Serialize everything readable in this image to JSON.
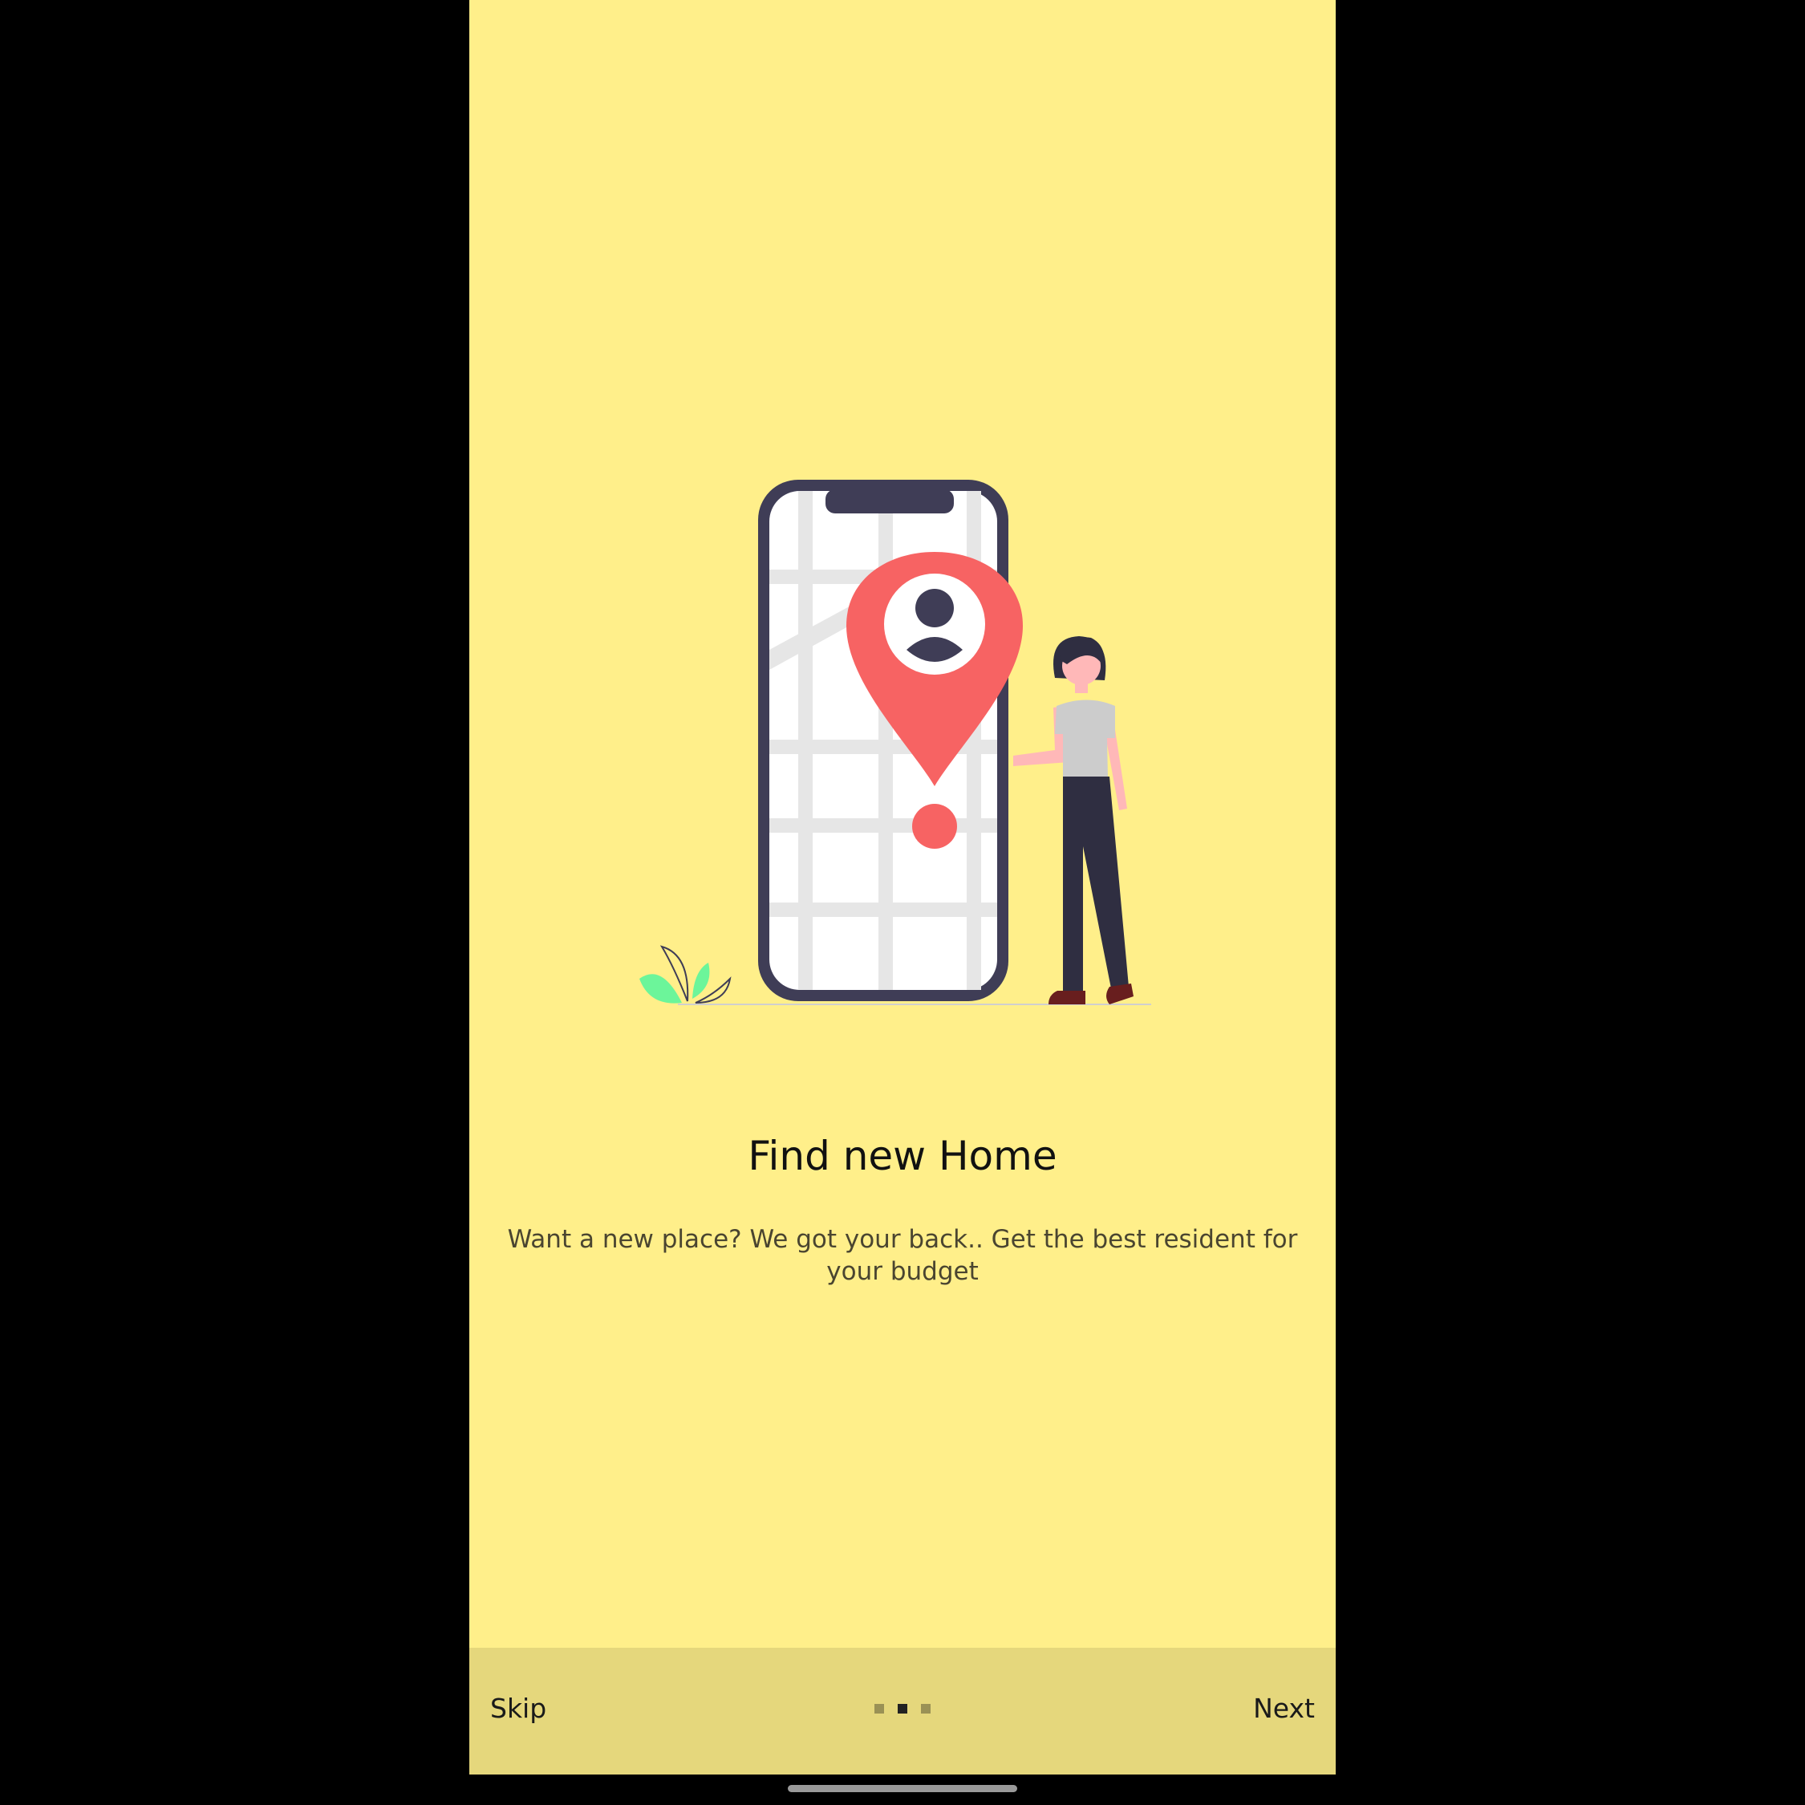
{
  "onboarding": {
    "title": "Find new Home",
    "description": "Want a new place? We got your back.. Get the best resident for your budget",
    "skip_label": "Skip",
    "next_label": "Next",
    "page_count": 3,
    "current_page": 2
  },
  "colors": {
    "background": "#FFEF8A",
    "bottom_bar": "#E5D77C",
    "pin": "#F76363",
    "phone_frame": "#3F3D56",
    "plant": "#6CF59A"
  },
  "icons": {
    "illustration": "phone-map-location-illustration"
  }
}
